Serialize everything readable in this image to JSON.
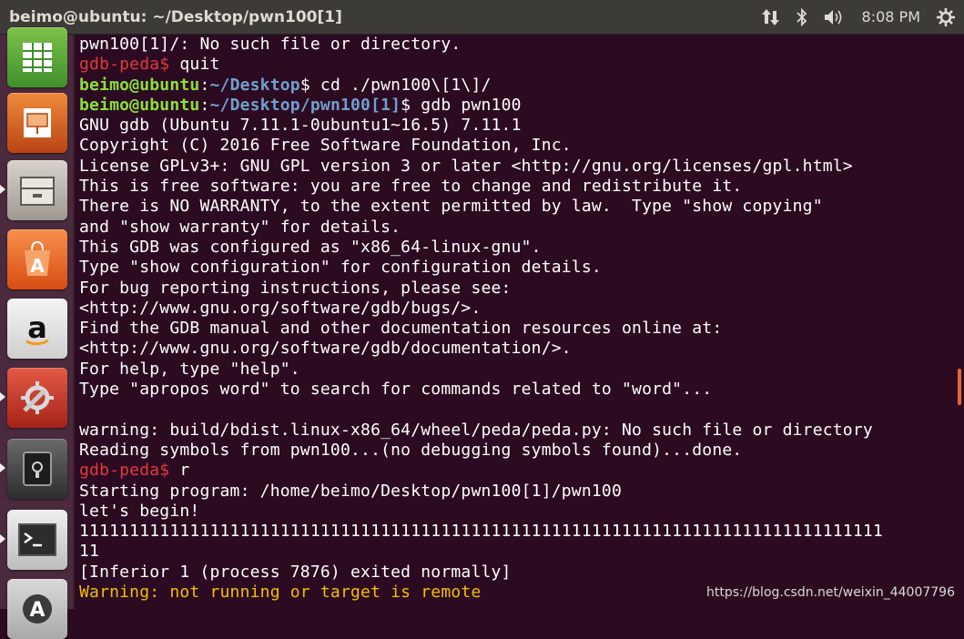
{
  "window": {
    "title": "beimo@ubuntu: ~/Desktop/pwn100[1]"
  },
  "tray": {
    "time": "8:08 PM",
    "icons": [
      "network-icon",
      "bluetooth-icon",
      "volume-icon",
      "settings-gear-icon"
    ]
  },
  "launcher": {
    "items": [
      "libreoffice-calc-icon",
      "libreoffice-impress-icon",
      "files-icon",
      "software-center-icon",
      "amazon-icon",
      "system-settings-icon",
      "disk-vault-icon",
      "terminal-icon",
      "software-updater-icon"
    ]
  },
  "terminal": {
    "lines": [
      {
        "segments": [
          {
            "text": "pwn100[1]/: No such file or directory.",
            "style": "plain"
          }
        ]
      },
      {
        "segments": [
          {
            "text": "gdb-peda$ ",
            "style": "peda"
          },
          {
            "text": "quit",
            "style": "plain"
          }
        ]
      },
      {
        "segments": [
          {
            "text": "beimo@ubuntu",
            "style": "user"
          },
          {
            "text": ":",
            "style": "plain"
          },
          {
            "text": "~/Desktop",
            "style": "path"
          },
          {
            "text": "$ cd ./pwn100\\[1\\]/",
            "style": "plain"
          }
        ]
      },
      {
        "segments": [
          {
            "text": "beimo@ubuntu",
            "style": "user"
          },
          {
            "text": ":",
            "style": "plain"
          },
          {
            "text": "~/Desktop/pwn100[1]",
            "style": "path"
          },
          {
            "text": "$ gdb pwn100",
            "style": "plain"
          }
        ]
      },
      {
        "segments": [
          {
            "text": "GNU gdb (Ubuntu 7.11.1-0ubuntu1~16.5) 7.11.1",
            "style": "plain"
          }
        ]
      },
      {
        "segments": [
          {
            "text": "Copyright (C) 2016 Free Software Foundation, Inc.",
            "style": "plain"
          }
        ]
      },
      {
        "segments": [
          {
            "text": "License GPLv3+: GNU GPL version 3 or later <http://gnu.org/licenses/gpl.html>",
            "style": "plain"
          }
        ]
      },
      {
        "segments": [
          {
            "text": "This is free software: you are free to change and redistribute it.",
            "style": "plain"
          }
        ]
      },
      {
        "segments": [
          {
            "text": "There is NO WARRANTY, to the extent permitted by law.  Type \"show copying\"",
            "style": "plain"
          }
        ]
      },
      {
        "segments": [
          {
            "text": "and \"show warranty\" for details.",
            "style": "plain"
          }
        ]
      },
      {
        "segments": [
          {
            "text": "This GDB was configured as \"x86_64-linux-gnu\".",
            "style": "plain"
          }
        ]
      },
      {
        "segments": [
          {
            "text": "Type \"show configuration\" for configuration details.",
            "style": "plain"
          }
        ]
      },
      {
        "segments": [
          {
            "text": "For bug reporting instructions, please see:",
            "style": "plain"
          }
        ]
      },
      {
        "segments": [
          {
            "text": "<http://www.gnu.org/software/gdb/bugs/>.",
            "style": "plain"
          }
        ]
      },
      {
        "segments": [
          {
            "text": "Find the GDB manual and other documentation resources online at:",
            "style": "plain"
          }
        ]
      },
      {
        "segments": [
          {
            "text": "<http://www.gnu.org/software/gdb/documentation/>.",
            "style": "plain"
          }
        ]
      },
      {
        "segments": [
          {
            "text": "For help, type \"help\".",
            "style": "plain"
          }
        ]
      },
      {
        "segments": [
          {
            "text": "Type \"apropos word\" to search for commands related to \"word\"...",
            "style": "plain"
          }
        ]
      },
      {
        "segments": [
          {
            "text": "",
            "style": "plain"
          }
        ]
      },
      {
        "segments": [
          {
            "text": "warning: build/bdist.linux-x86_64/wheel/peda/peda.py: No such file or directory",
            "style": "plain"
          }
        ]
      },
      {
        "segments": [
          {
            "text": "Reading symbols from pwn100...(no debugging symbols found)...done.",
            "style": "plain"
          }
        ]
      },
      {
        "segments": [
          {
            "text": "gdb-peda$ ",
            "style": "peda"
          },
          {
            "text": "r",
            "style": "plain"
          }
        ]
      },
      {
        "segments": [
          {
            "text": "Starting program: /home/beimo/Desktop/pwn100[1]/pwn100",
            "style": "plain"
          }
        ]
      },
      {
        "segments": [
          {
            "text": "let's begin!",
            "style": "plain"
          }
        ]
      },
      {
        "segments": [
          {
            "text": "11111111111111111111111111111111111111111111111111111111111111111111111111111111",
            "style": "plain"
          }
        ]
      },
      {
        "segments": [
          {
            "text": "11",
            "style": "plain"
          }
        ]
      },
      {
        "segments": [
          {
            "text": "[Inferior 1 (process 7876) exited normally]",
            "style": "plain"
          }
        ]
      },
      {
        "segments": [
          {
            "text": "Warning: not running or target is remote",
            "style": "warn"
          }
        ]
      }
    ]
  },
  "watermark": "https://blog.csdn.net/weixin_44007796",
  "colors": {
    "background": "#2c0b22",
    "prompt_peda": "#e23a3a",
    "prompt_user": "#8ae234",
    "prompt_path": "#729fcf",
    "warning": "#f0c000"
  }
}
